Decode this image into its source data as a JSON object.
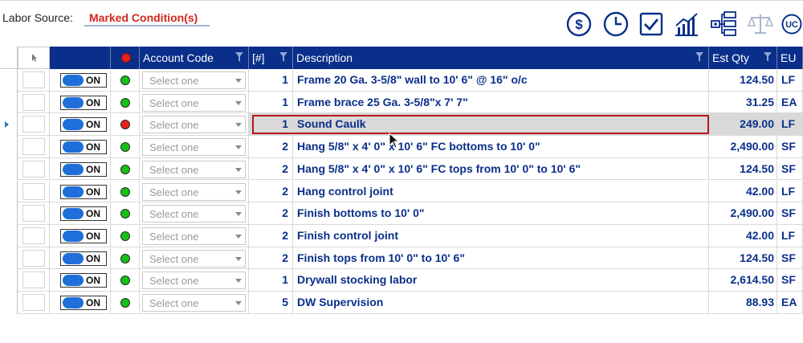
{
  "labor_source": {
    "label": "Labor Source:",
    "value": "Marked Condition(s)"
  },
  "toolbar": {
    "icons": [
      "dollar-icon",
      "clock-icon",
      "checkbox-icon",
      "bar-chart-icon",
      "hierarchy-icon",
      "scales-icon",
      "uc-icon"
    ],
    "uc_label": "UC"
  },
  "grid": {
    "headers": {
      "account_code": "Account Code",
      "count": "[#]",
      "description": "Description",
      "est_qty": "Est Qty",
      "eu": "EU"
    },
    "toggle_label": "ON",
    "account_placeholder": "Select one",
    "colors": {
      "green": "#14c114",
      "red": "#e3231b",
      "header": "#0a2f8a"
    },
    "rows": [
      {
        "status": "green",
        "count": "1",
        "description": "Frame 20 Ga. 3-5/8\" wall to 10' 6\" @ 16\" o/c",
        "qty": "124.50",
        "eu": "LF"
      },
      {
        "status": "green",
        "count": "1",
        "description": "Frame brace 25 Ga. 3-5/8\"x 7' 7\"",
        "qty": "31.25",
        "eu": "EA"
      },
      {
        "status": "red",
        "count": "1",
        "description": "Sound Caulk",
        "qty": "249.00",
        "eu": "LF",
        "selected": true
      },
      {
        "status": "green",
        "count": "2",
        "description": "Hang 5/8\" x 4' 0\" x 10' 6\" FC bottoms to 10' 0\"",
        "qty": "2,490.00",
        "eu": "SF"
      },
      {
        "status": "green",
        "count": "2",
        "description": "Hang 5/8\" x 4' 0\" x 10' 6\" FC tops from 10' 0\" to 10' 6\"",
        "qty": "124.50",
        "eu": "SF"
      },
      {
        "status": "green",
        "count": "2",
        "description": "Hang control joint",
        "qty": "42.00",
        "eu": "LF"
      },
      {
        "status": "green",
        "count": "2",
        "description": "Finish bottoms to 10' 0\"",
        "qty": "2,490.00",
        "eu": "SF"
      },
      {
        "status": "green",
        "count": "2",
        "description": "Finish control joint",
        "qty": "42.00",
        "eu": "LF"
      },
      {
        "status": "green",
        "count": "2",
        "description": "Finish tops from 10' 0\" to 10' 6\"",
        "qty": "124.50",
        "eu": "SF"
      },
      {
        "status": "green",
        "count": "1",
        "description": "Drywall stocking labor",
        "qty": "2,614.50",
        "eu": "SF"
      },
      {
        "status": "green",
        "count": "5",
        "description": "DW Supervision",
        "qty": "88.93",
        "eu": "EA"
      }
    ]
  }
}
